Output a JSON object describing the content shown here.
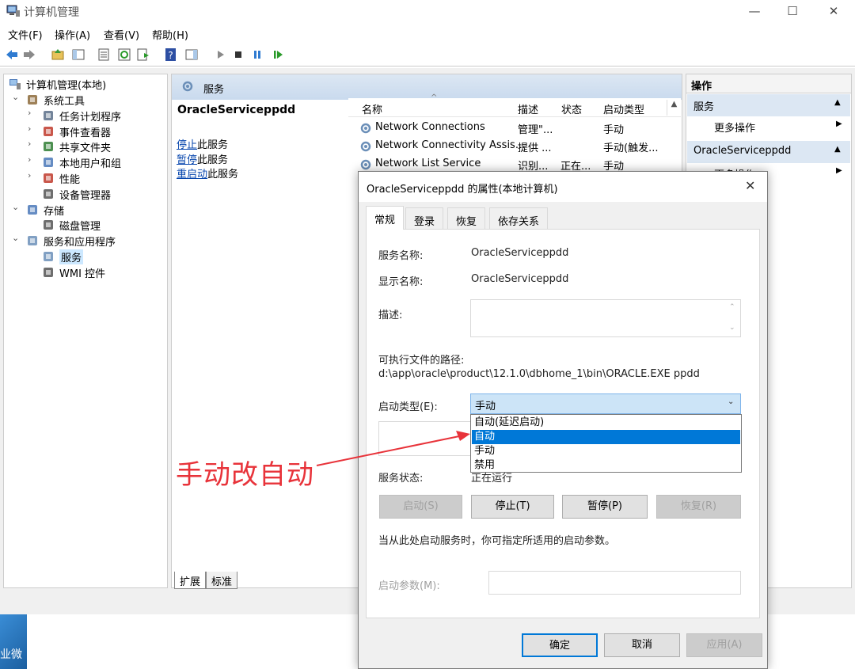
{
  "window": {
    "title": "计算机管理"
  },
  "menu": [
    "文件(F)",
    "操作(A)",
    "查看(V)",
    "帮助(H)"
  ],
  "tree": {
    "root": "计算机管理(本地)",
    "items": [
      {
        "label": "系统工具",
        "indent": 0,
        "expander": "v"
      },
      {
        "label": "任务计划程序",
        "indent": 1,
        "expander": ">"
      },
      {
        "label": "事件查看器",
        "indent": 1,
        "expander": ">"
      },
      {
        "label": "共享文件夹",
        "indent": 1,
        "expander": ">"
      },
      {
        "label": "本地用户和组",
        "indent": 1,
        "expander": ">"
      },
      {
        "label": "性能",
        "indent": 1,
        "expander": ">"
      },
      {
        "label": "设备管理器",
        "indent": 1,
        "expander": ""
      },
      {
        "label": "存储",
        "indent": 0,
        "expander": "v"
      },
      {
        "label": "磁盘管理",
        "indent": 1,
        "expander": ""
      },
      {
        "label": "服务和应用程序",
        "indent": 0,
        "expander": "v"
      },
      {
        "label": "服务",
        "indent": 1,
        "expander": ""
      },
      {
        "label": "WMI 控件",
        "indent": 1,
        "expander": ""
      }
    ]
  },
  "center": {
    "header": "服务",
    "service_name": "OracleServiceppdd",
    "actions": [
      {
        "link": "停止",
        "rest": "此服务"
      },
      {
        "link": "暂停",
        "rest": "此服务"
      },
      {
        "link": "重启动",
        "rest": "此服务"
      }
    ],
    "columns": [
      "名称",
      "描述",
      "状态",
      "启动类型"
    ],
    "rows": [
      {
        "name": "Network Connections",
        "desc": "管理\"...",
        "status": "",
        "startup": "手动"
      },
      {
        "name": "Network Connectivity Assis...",
        "desc": "提供 ...",
        "status": "",
        "startup": "手动(触发..."
      },
      {
        "name": "Network List Service",
        "desc": "识别...",
        "status": "正在...",
        "startup": "手动"
      }
    ],
    "bottom_tabs": [
      "扩展",
      "标准"
    ]
  },
  "right": {
    "header": "操作",
    "sections": [
      {
        "title": "服务",
        "more": "更多操作"
      },
      {
        "title": "OracleServiceppdd",
        "more": "更多操作"
      }
    ]
  },
  "dialog": {
    "title": "OracleServiceppdd 的属性(本地计算机)",
    "tabs": [
      "常规",
      "登录",
      "恢复",
      "依存关系"
    ],
    "service_name_label": "服务名称:",
    "service_name_value": "OracleServiceppdd",
    "display_name_label": "显示名称:",
    "display_name_value": "OracleServiceppdd",
    "desc_label": "描述:",
    "path_label": "可执行文件的路径:",
    "path_value": "d:\\app\\oracle\\product\\12.1.0\\dbhome_1\\bin\\ORACLE.EXE ppdd",
    "startup_label": "启动类型(E):",
    "startup_value": "手动",
    "startup_options": [
      "自动(延迟启动)",
      "自动",
      "手动",
      "禁用"
    ],
    "selected_option": "自动",
    "status_label": "服务状态:",
    "status_value": "正在运行",
    "buttons": {
      "start": "启动(S)",
      "stop": "停止(T)",
      "pause": "暂停(P)",
      "resume": "恢复(R)"
    },
    "hint": "当从此处启动服务时，你可指定所适用的启动参数。",
    "param_label": "启动参数(M):",
    "ok": "确定",
    "cancel": "取消",
    "apply": "应用(A)"
  },
  "annotation": {
    "text": "手动改自动",
    "color": "#e8333a"
  },
  "desktop": {
    "label": "企业微"
  },
  "colors": {
    "accent": "#0078d7",
    "link": "#0645ad",
    "header_bg": "#dce7f3"
  }
}
